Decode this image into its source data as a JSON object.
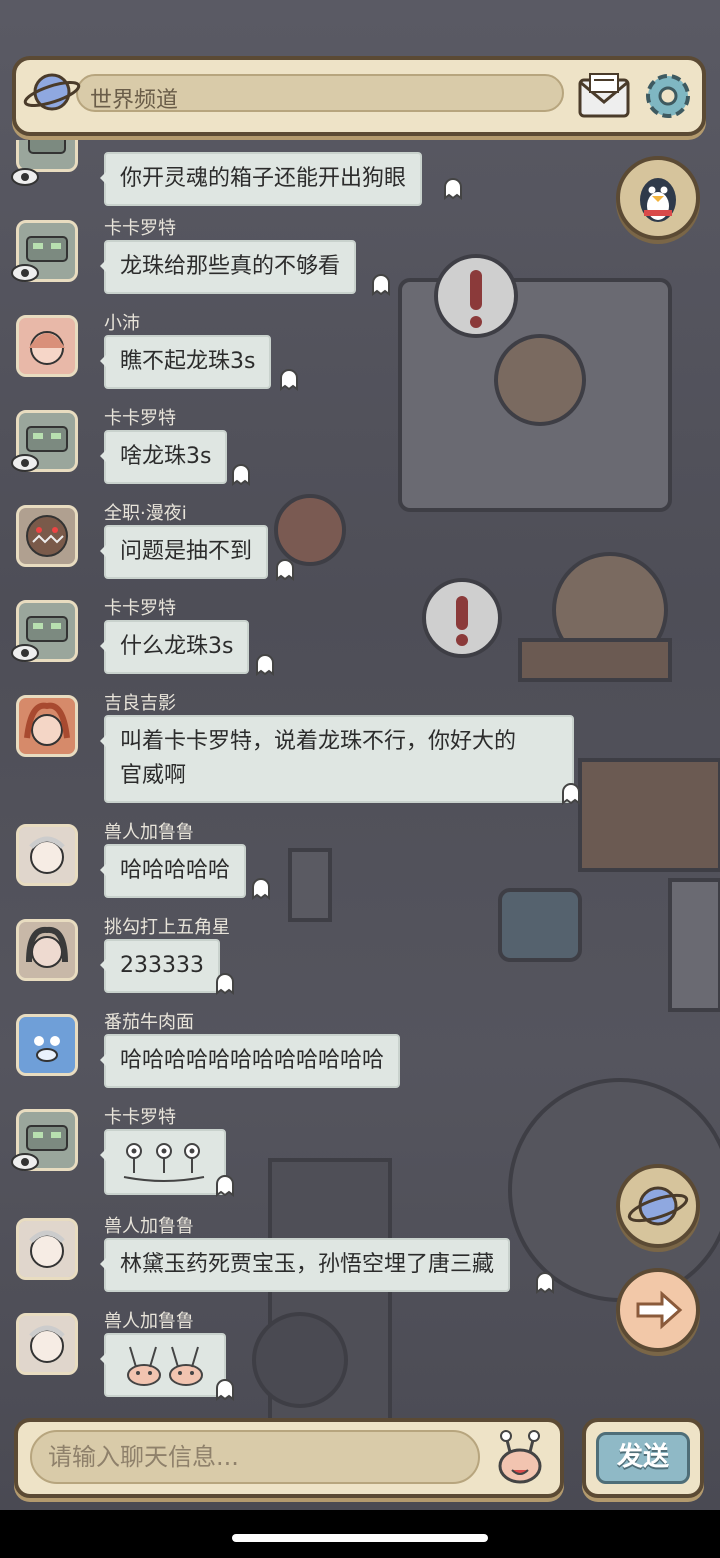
{
  "header": {
    "channel_title": "世界频道"
  },
  "messages": [
    {
      "name": "",
      "text": "你开灵魂的箱子还能开出狗眼",
      "avatar": "robot"
    },
    {
      "name": "卡卡罗特",
      "text": "龙珠给那些真的不够看",
      "avatar": "robot"
    },
    {
      "name": "小沛",
      "text": "瞧不起龙珠3s",
      "avatar": "girl-pink"
    },
    {
      "name": "卡卡罗特",
      "text": "啥龙珠3s",
      "avatar": "robot"
    },
    {
      "name": "全职·漫夜i",
      "text": "问题是抽不到",
      "avatar": "monster"
    },
    {
      "name": "卡卡罗特",
      "text": "什么龙珠3s",
      "avatar": "robot"
    },
    {
      "name": "吉良吉影",
      "text_lines": [
        "叫着卡卡罗特，说着龙珠不行，你好大的",
        "官威啊"
      ],
      "avatar": "girl-red"
    },
    {
      "name": "兽人加鲁鲁",
      "text": "哈哈哈哈哈",
      "avatar": "girl-white"
    },
    {
      "name": "挑勾打上五角星",
      "text": "233333",
      "avatar": "girl-dark"
    },
    {
      "name": "番茄牛肉面",
      "text": "哈哈哈哈哈哈哈哈哈哈哈哈",
      "avatar": "blue-cat"
    },
    {
      "name": "卡卡罗特",
      "text": "",
      "sticker": "eye-stalks",
      "avatar": "robot"
    },
    {
      "name": "兽人加鲁鲁",
      "text": "林黛玉药死贾宝玉，孙悟空埋了唐三藏",
      "avatar": "girl-white"
    },
    {
      "name": "兽人加鲁鲁",
      "text": "",
      "sticker": "bunny-faces",
      "avatar": "girl-white"
    }
  ],
  "input": {
    "placeholder": "请输入聊天信息..."
  },
  "send": {
    "label": "发送"
  },
  "icons": [
    "planet-icon",
    "mail-icon",
    "gear-icon",
    "penguin-icon",
    "world-icon",
    "arrow-right-icon",
    "emoji-icon",
    "eye-icon",
    "ghost-icon"
  ],
  "colors": {
    "panel": "#eee3c7",
    "bubble": "#dfe6e2",
    "send_button": "#8fb9c6"
  }
}
